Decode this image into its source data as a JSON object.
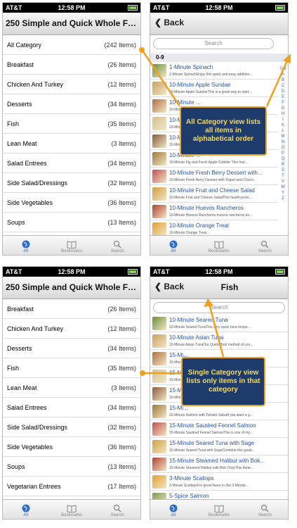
{
  "status": {
    "carrier": "AT&T",
    "time": "12:58 PM"
  },
  "app_title": "250 Simple and Quick Whole Foods...",
  "back_label": "Back",
  "fish_title": "Fish",
  "search_placeholder": "Search",
  "section_header": "0-9",
  "tabs": [
    {
      "label": "All"
    },
    {
      "label": "Bookmarks"
    },
    {
      "label": "Search"
    }
  ],
  "cats_top": [
    {
      "name": "All Category",
      "count": "(242 Items)"
    },
    {
      "name": "Breakfast",
      "count": "(26 Items)"
    },
    {
      "name": "Chicken And Turkey",
      "count": "(12 Items)"
    },
    {
      "name": "Desserts",
      "count": "(34 Items)"
    },
    {
      "name": "Fish",
      "count": "(35 Items)"
    },
    {
      "name": "Lean Meat",
      "count": "(3 Items)"
    },
    {
      "name": "Salad Entrees",
      "count": "(34 Items)"
    },
    {
      "name": "Side Salad/Dressings",
      "count": "(32 Items)"
    },
    {
      "name": "Side Vegetables",
      "count": "(36 Items)"
    },
    {
      "name": "Soups",
      "count": "(13 Items)"
    }
  ],
  "cats_bottom": [
    {
      "name": "Breakfast",
      "count": "(26 Items)"
    },
    {
      "name": "Chicken And Turkey",
      "count": "(12 Items)"
    },
    {
      "name": "Desserts",
      "count": "(34 Items)"
    },
    {
      "name": "Fish",
      "count": "(35 Items)"
    },
    {
      "name": "Lean Meat",
      "count": "(3 Items)"
    },
    {
      "name": "Salad Entrees",
      "count": "(34 Items)"
    },
    {
      "name": "Side Salad/Dressings",
      "count": "(32 Items)"
    },
    {
      "name": "Side Vegetables",
      "count": "(36 Items)"
    },
    {
      "name": "Soups",
      "count": "(13 Items)"
    },
    {
      "name": "Vegetarian Entrees",
      "count": "(17 Items)"
    }
  ],
  "index_letters": [
    "0-9",
    "A",
    "B",
    "C",
    "D",
    "E",
    "F",
    "G",
    "H",
    "I",
    "K",
    "L",
    "M",
    "N",
    "O",
    "P",
    "Q",
    "R",
    "S",
    "T",
    "V",
    "W",
    "Y",
    "Z"
  ],
  "recipes_all": [
    {
      "title": "1-Minute Spinach",
      "sub": "1-Minute SpinachEnjoy this quick and easy addition..."
    },
    {
      "title": "10-Minute Apple Sundae",
      "sub": "10-Minute Apple SundaeThis is a great way to start..."
    },
    {
      "title": "10-Minute ...",
      "sub": "10-Minute ..."
    },
    {
      "title": "10-Minute ...",
      "sub": "10-Minute ..."
    },
    {
      "title": "10-Minute ...",
      "sub": "10-Minute ..."
    },
    {
      "title": "10-Minute ...",
      "sub": "10-Minute Fig and Fresh Apple Cobbler This fruit..."
    },
    {
      "title": "10-Minute Fresh Berry Dessert with...",
      "sub": "10-Minute Fresh Berry Dessert with Yogurt and Choco..."
    },
    {
      "title": "10-Minute Fruit and Cheese Salad",
      "sub": "10-Minute Fruit and Cheese SaladThis health-prom..."
    },
    {
      "title": "10-Minute Huevos Rancheros",
      "sub": "10-Minute Huevos Rancheros huevos rancheros do..."
    },
    {
      "title": "10-Minute Orange Treat",
      "sub": "10-Minute Orange Treat..."
    }
  ],
  "recipes_fish": [
    {
      "title": "10-Minute Seared Tuna",
      "sub": "10-Minute Seared TunaThis very quick tuna recipe..."
    },
    {
      "title": "10-Minute Asian Tuna",
      "sub": "10-Minute Asian TunaOur Quick Broil method of coo..."
    },
    {
      "title": "15-Mi...",
      "sub": "15-Minute ..."
    },
    {
      "title": "15-Mi...",
      "sub": "15-Minute ..."
    },
    {
      "title": "15-Mi...",
      "sub": "15-Minute ..."
    },
    {
      "title": "15-Mi...",
      "sub": "15-Minute Salmon with Tomato Salsalf you want a g..."
    },
    {
      "title": "15-Minute Sautéed Fennel Salmon",
      "sub": "15-Minute Sautéed Fennel SalmonThis is one of my..."
    },
    {
      "title": "15-Minute Seared Tuna with Sage",
      "sub": "15-Minute Seared Tuna with SageCombine this great..."
    },
    {
      "title": "15-Minute Steamed Halibut with Bok...",
      "sub": "15-Minute Steamed Halibut with Bok ChoyThis thirte..."
    },
    {
      "title": "3-Minute Scallops",
      "sub": "3-Minute ScallopsFor great flavor in this 3-Minute..."
    },
    {
      "title": "5-Spice Salmon",
      "sub": ""
    }
  ],
  "callout_all": "All Category view lists all items in alphabetical order",
  "callout_single": "Single Category view lists only items in that category",
  "colors": {
    "accent": "#f0a020",
    "callout_bg": "#1d3c6b",
    "callout_text": "#ffd94a",
    "link": "#2853a0"
  }
}
